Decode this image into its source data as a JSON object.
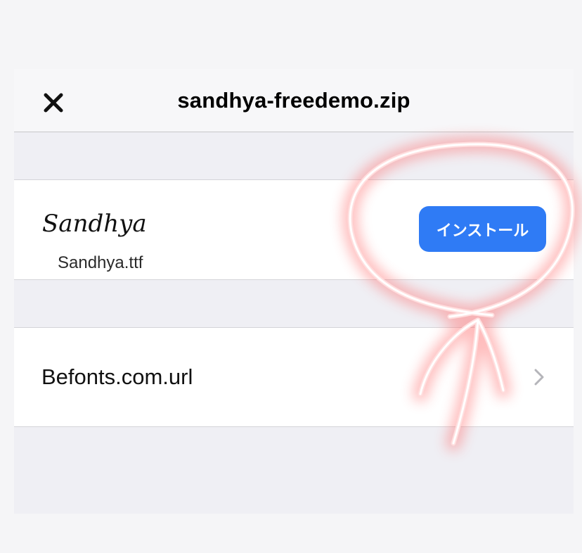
{
  "navbar": {
    "title": "sandhya-freedemo.zip",
    "close_icon": "close-icon"
  },
  "font_item": {
    "preview": "Sandhya",
    "file_name": "Sandhya.ttf",
    "install_label": "インストール"
  },
  "link_item": {
    "label": "Befonts.com.url",
    "chevron_icon": "chevron-right-icon"
  },
  "colors": {
    "accent": "#2f7bf5",
    "annotation": "#ff6f6f"
  }
}
